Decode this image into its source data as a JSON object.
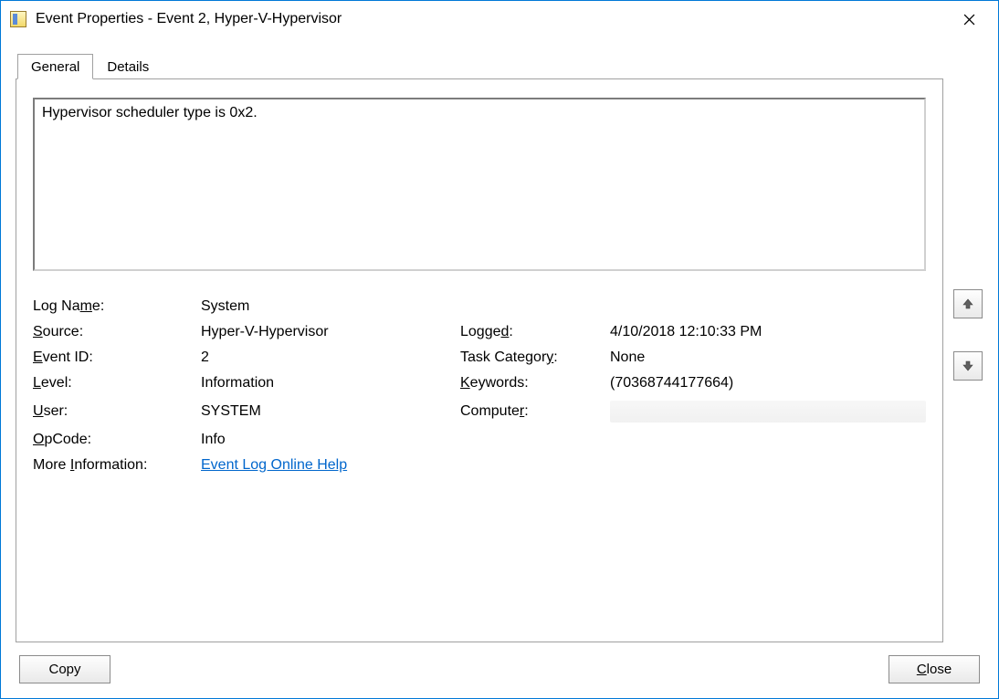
{
  "window": {
    "title": "Event Properties - Event 2, Hyper-V-Hypervisor"
  },
  "tabs": {
    "general": "General",
    "details": "Details"
  },
  "event": {
    "description": "Hypervisor scheduler type is 0x2.",
    "labels": {
      "log_name": "Log Name:",
      "source": "Source:",
      "event_id": "Event ID:",
      "level": "Level:",
      "user": "User:",
      "opcode": "OpCode:",
      "more_info": "More Information:",
      "logged": "Logged:",
      "task_category": "Task Category:",
      "keywords": "Keywords:",
      "computer": "Computer:"
    },
    "log_name": "System",
    "source": "Hyper-V-Hypervisor",
    "logged": "4/10/2018 12:10:33 PM",
    "event_id": "2",
    "task_category": "None",
    "level": "Information",
    "keywords": "(70368744177664)",
    "user": "SYSTEM",
    "computer": "",
    "opcode": "Info",
    "more_info_link": "Event Log Online Help"
  },
  "buttons": {
    "copy": "Copy",
    "close": "Close"
  }
}
